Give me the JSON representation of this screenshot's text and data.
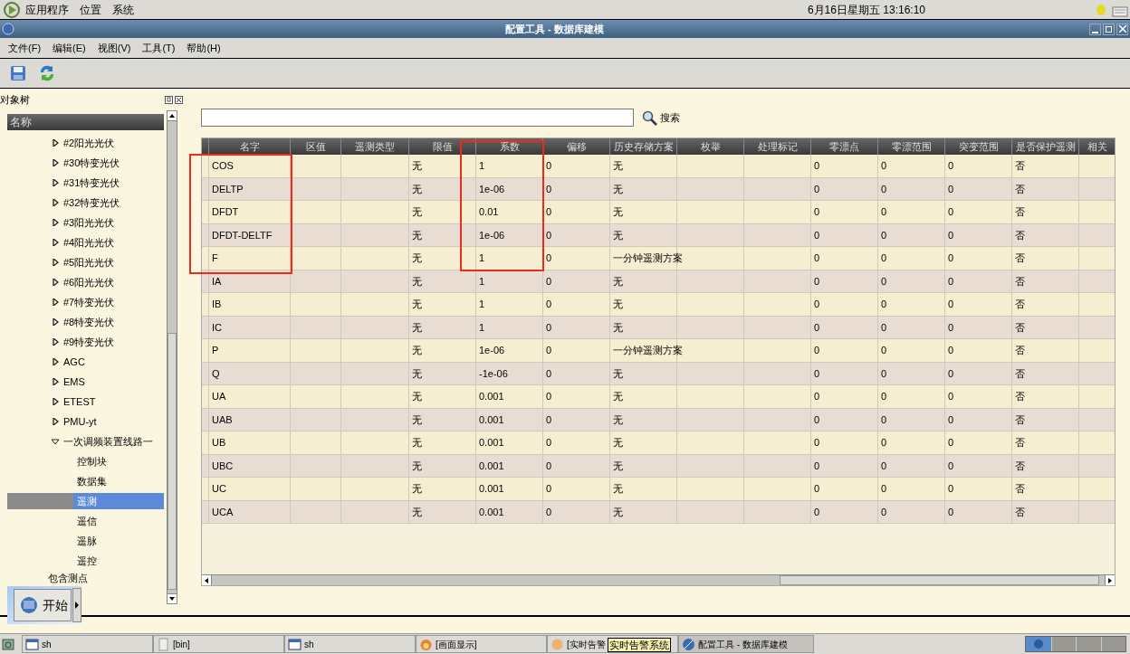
{
  "top_panel": {
    "menus": [
      "应用程序",
      "位置",
      "系统"
    ],
    "clock": "6月16日星期五 13:16:10"
  },
  "window": {
    "title": "配置工具 - 数据库建模"
  },
  "menu_bar": [
    "文件(F)",
    "编辑(E)",
    "视图(V)",
    "工具(T)",
    "帮助(H)"
  ],
  "toolbar": [
    {
      "kind": "save"
    },
    {
      "kind": "refresh"
    }
  ],
  "tree_panel": {
    "title": "对象树",
    "column": "名称",
    "items": [
      {
        "label": "#2阳光光伏",
        "expanded": false,
        "selected": false
      },
      {
        "label": "#30特变光伏",
        "expanded": false,
        "selected": false
      },
      {
        "label": "#31特变光伏",
        "expanded": false,
        "selected": false
      },
      {
        "label": "#32特变光伏",
        "expanded": false,
        "selected": false
      },
      {
        "label": "#3阳光光伏",
        "expanded": false,
        "selected": false
      },
      {
        "label": "#4阳光光伏",
        "expanded": false,
        "selected": false
      },
      {
        "label": "#5阳光光伏",
        "expanded": false,
        "selected": false
      },
      {
        "label": "#6阳光光伏",
        "expanded": false,
        "selected": false
      },
      {
        "label": "#7特变光伏",
        "expanded": false,
        "selected": false
      },
      {
        "label": "#8特变光伏",
        "expanded": false,
        "selected": false
      },
      {
        "label": "#9特变光伏",
        "expanded": false,
        "selected": false
      },
      {
        "label": "AGC",
        "expanded": false,
        "selected": false
      },
      {
        "label": "EMS",
        "expanded": false,
        "selected": false
      },
      {
        "label": "ETEST",
        "expanded": false,
        "selected": false
      },
      {
        "label": "PMU-yt",
        "expanded": false,
        "selected": false
      },
      {
        "label": "一次调频装置线路一",
        "expanded": true,
        "selected": false,
        "children": [
          {
            "label": "控制块",
            "selected": false
          },
          {
            "label": "数据集",
            "selected": false
          },
          {
            "label": "遥测",
            "selected": true
          },
          {
            "label": "遥信",
            "selected": false
          },
          {
            "label": "遥脉",
            "selected": false
          },
          {
            "label": "遥控",
            "selected": false
          }
        ]
      }
    ],
    "footer_item": "包含测点"
  },
  "search": {
    "button": "搜索"
  },
  "table": {
    "columns": [
      "名字",
      "区值",
      "遥测类型",
      "限值",
      "系数",
      "偏移",
      "历史存储方案",
      "枚举",
      "处理标记",
      "零漂点",
      "零漂范围",
      "突变范围",
      "是否保护遥测",
      "相关"
    ],
    "rows": [
      [
        "COS",
        "",
        "",
        "无",
        "1",
        "0",
        "无",
        "",
        "",
        "0",
        "0",
        "0",
        "否"
      ],
      [
        "DELTP",
        "",
        "",
        "无",
        "1e-06",
        "0",
        "无",
        "",
        "",
        "0",
        "0",
        "0",
        "否"
      ],
      [
        "DFDT",
        "",
        "",
        "无",
        "0.01",
        "0",
        "无",
        "",
        "",
        "0",
        "0",
        "0",
        "否"
      ],
      [
        "DFDT-DELTF",
        "",
        "",
        "无",
        "1e-06",
        "0",
        "无",
        "",
        "",
        "0",
        "0",
        "0",
        "否"
      ],
      [
        "F",
        "",
        "",
        "无",
        "1",
        "0",
        "一分钟遥测方案",
        "",
        "",
        "0",
        "0",
        "0",
        "否"
      ],
      [
        "IA",
        "",
        "",
        "无",
        "1",
        "0",
        "无",
        "",
        "",
        "0",
        "0",
        "0",
        "否"
      ],
      [
        "IB",
        "",
        "",
        "无",
        "1",
        "0",
        "无",
        "",
        "",
        "0",
        "0",
        "0",
        "否"
      ],
      [
        "IC",
        "",
        "",
        "无",
        "1",
        "0",
        "无",
        "",
        "",
        "0",
        "0",
        "0",
        "否"
      ],
      [
        "P",
        "",
        "",
        "无",
        "1e-06",
        "0",
        "一分钟遥测方案",
        "",
        "",
        "0",
        "0",
        "0",
        "否"
      ],
      [
        "Q",
        "",
        "",
        "无",
        "-1e-06",
        "0",
        "无",
        "",
        "",
        "0",
        "0",
        "0",
        "否"
      ],
      [
        "UA",
        "",
        "",
        "无",
        "0.001",
        "0",
        "无",
        "",
        "",
        "0",
        "0",
        "0",
        "否"
      ],
      [
        "UAB",
        "",
        "",
        "无",
        "0.001",
        "0",
        "无",
        "",
        "",
        "0",
        "0",
        "0",
        "否"
      ],
      [
        "UB",
        "",
        "",
        "无",
        "0.001",
        "0",
        "无",
        "",
        "",
        "0",
        "0",
        "0",
        "否"
      ],
      [
        "UBC",
        "",
        "",
        "无",
        "0.001",
        "0",
        "无",
        "",
        "",
        "0",
        "0",
        "0",
        "否"
      ],
      [
        "UC",
        "",
        "",
        "无",
        "0.001",
        "0",
        "无",
        "",
        "",
        "0",
        "0",
        "0",
        "否"
      ],
      [
        "UCA",
        "",
        "",
        "无",
        "0.001",
        "0",
        "无",
        "",
        "",
        "0",
        "0",
        "0",
        "否"
      ]
    ]
  },
  "start_button": {
    "label": "开始"
  },
  "taskbar": [
    {
      "label": "sh",
      "kind": "terminal",
      "selected": false
    },
    {
      "label": "[bin]",
      "kind": "file",
      "selected": false
    },
    {
      "label": "sh",
      "kind": "terminal",
      "selected": false
    },
    {
      "label": "[画面显示]",
      "kind": "flame",
      "selected": false
    },
    {
      "label": "[实时告警",
      "kind": "orb",
      "selected": false
    },
    {
      "label": "配置工具 - 数据库建模",
      "kind": "globe",
      "selected": true
    }
  ],
  "tooltip": "实时告警系统"
}
